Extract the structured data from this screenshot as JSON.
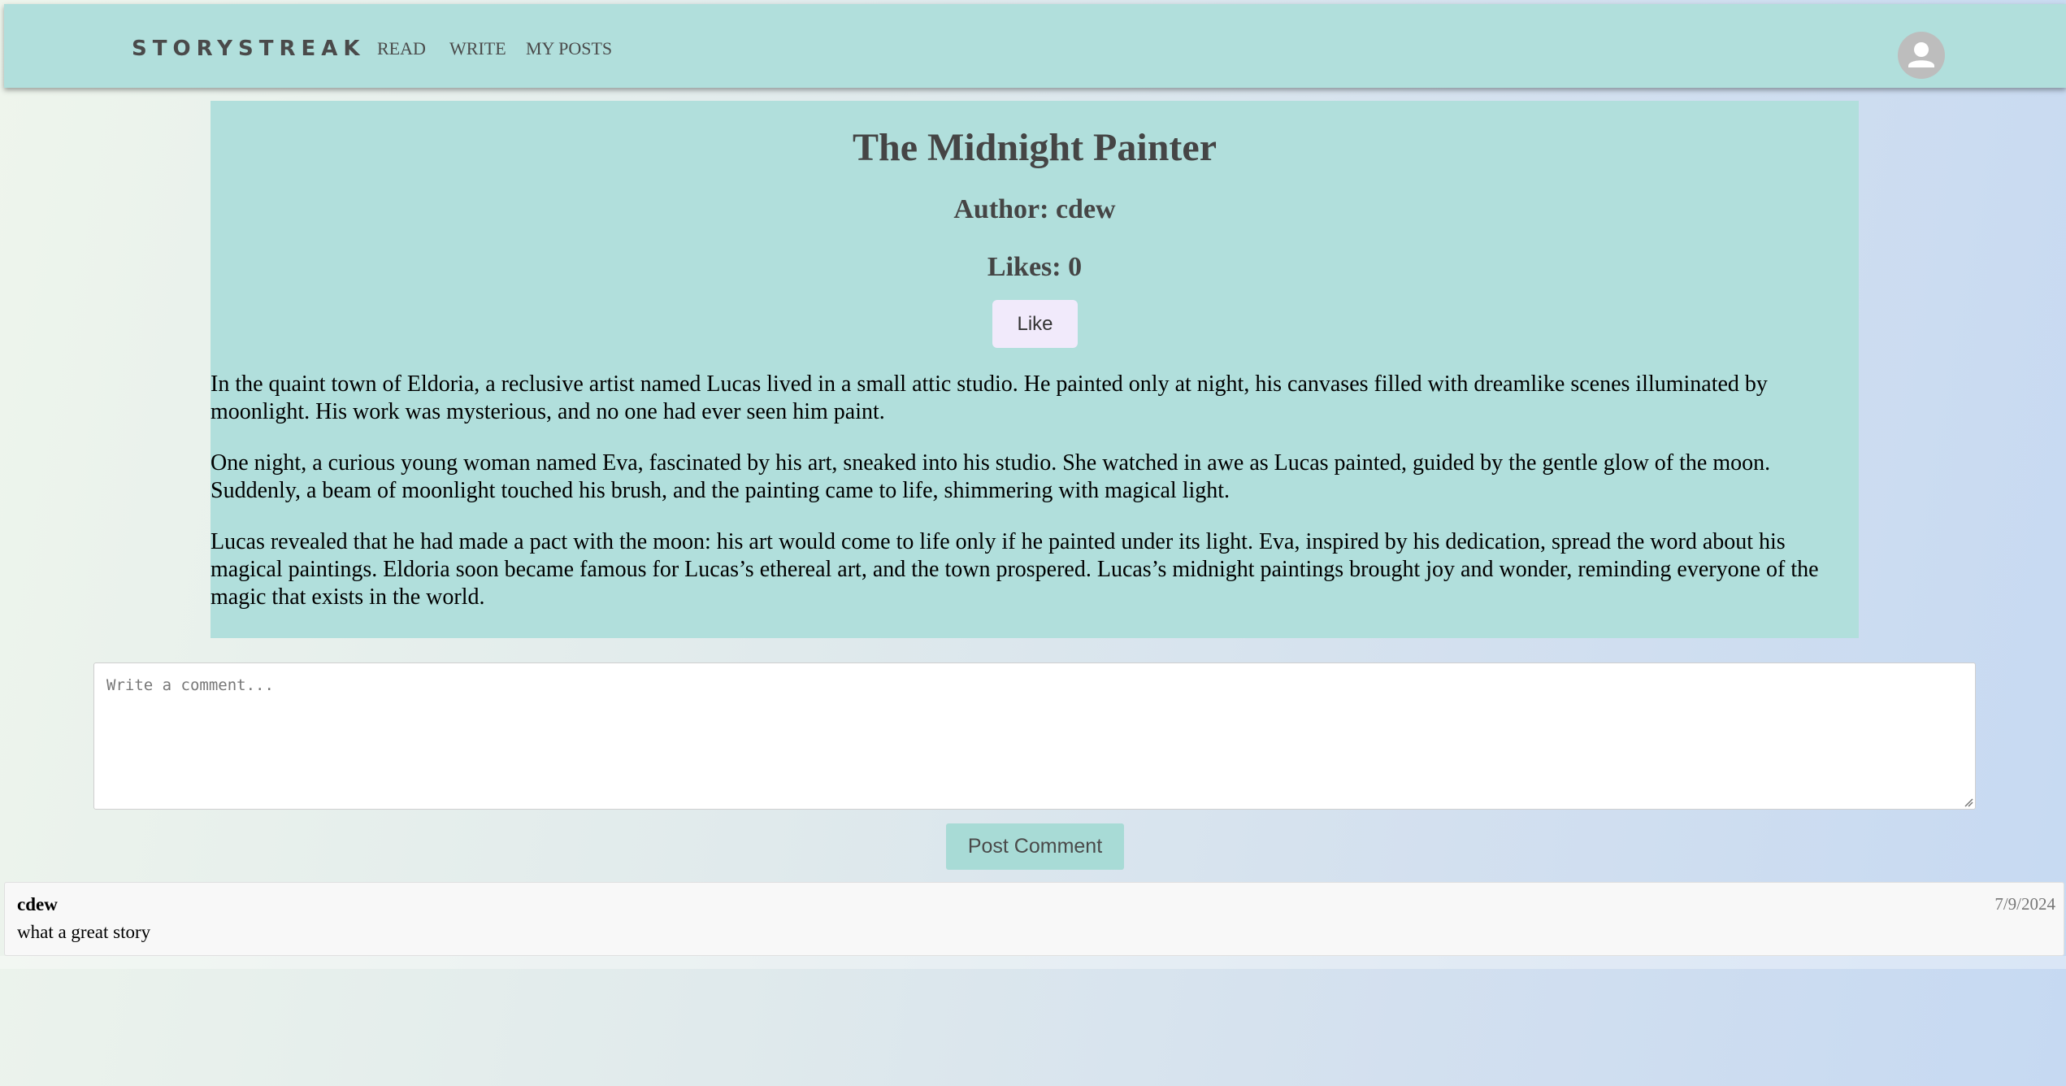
{
  "nav": {
    "brand": "STORYSTREAK",
    "links": [
      "READ",
      "WRITE",
      "MY POSTS"
    ],
    "avatar_icon": "user-icon"
  },
  "story": {
    "title": "The Midnight Painter",
    "author_line": "Author: cdew",
    "likes_line": "Likes: 0",
    "like_label": "Like",
    "paragraphs": [
      "In the quaint town of Eldoria, a reclusive artist named Lucas lived in a small attic studio. He painted only at night, his canvases filled with dreamlike scenes illuminated by moonlight. His work was mysterious, and no one had ever seen him paint.",
      "One night, a curious young woman named Eva, fascinated by his art, sneaked into his studio. She watched in awe as Lucas painted, guided by the gentle glow of the moon. Suddenly, a beam of moonlight touched his brush, and the painting came to life, shimmering with magical light.",
      "Lucas revealed that he had made a pact with the moon: his art would come to life only if he painted under its light. Eva, inspired by his dedication, spread the word about his magical paintings. Eldoria soon became famous for Lucas’s ethereal art, and the town prospered. Lucas’s midnight paintings brought joy and wonder, reminding everyone of the magic that exists in the world."
    ]
  },
  "comment_form": {
    "placeholder": "Write a comment...",
    "value": "",
    "submit_label": "Post Comment"
  },
  "comments": [
    {
      "author": "cdew",
      "text": "what a great story",
      "date": "7/9/2024"
    }
  ],
  "colors": {
    "navbar_bg": "#b1dfdc",
    "card_bg": "#b1dfdc",
    "like_button_bg": "#f1eafb",
    "post_button_bg": "#a8dbd6",
    "heading_text": "#454545"
  }
}
